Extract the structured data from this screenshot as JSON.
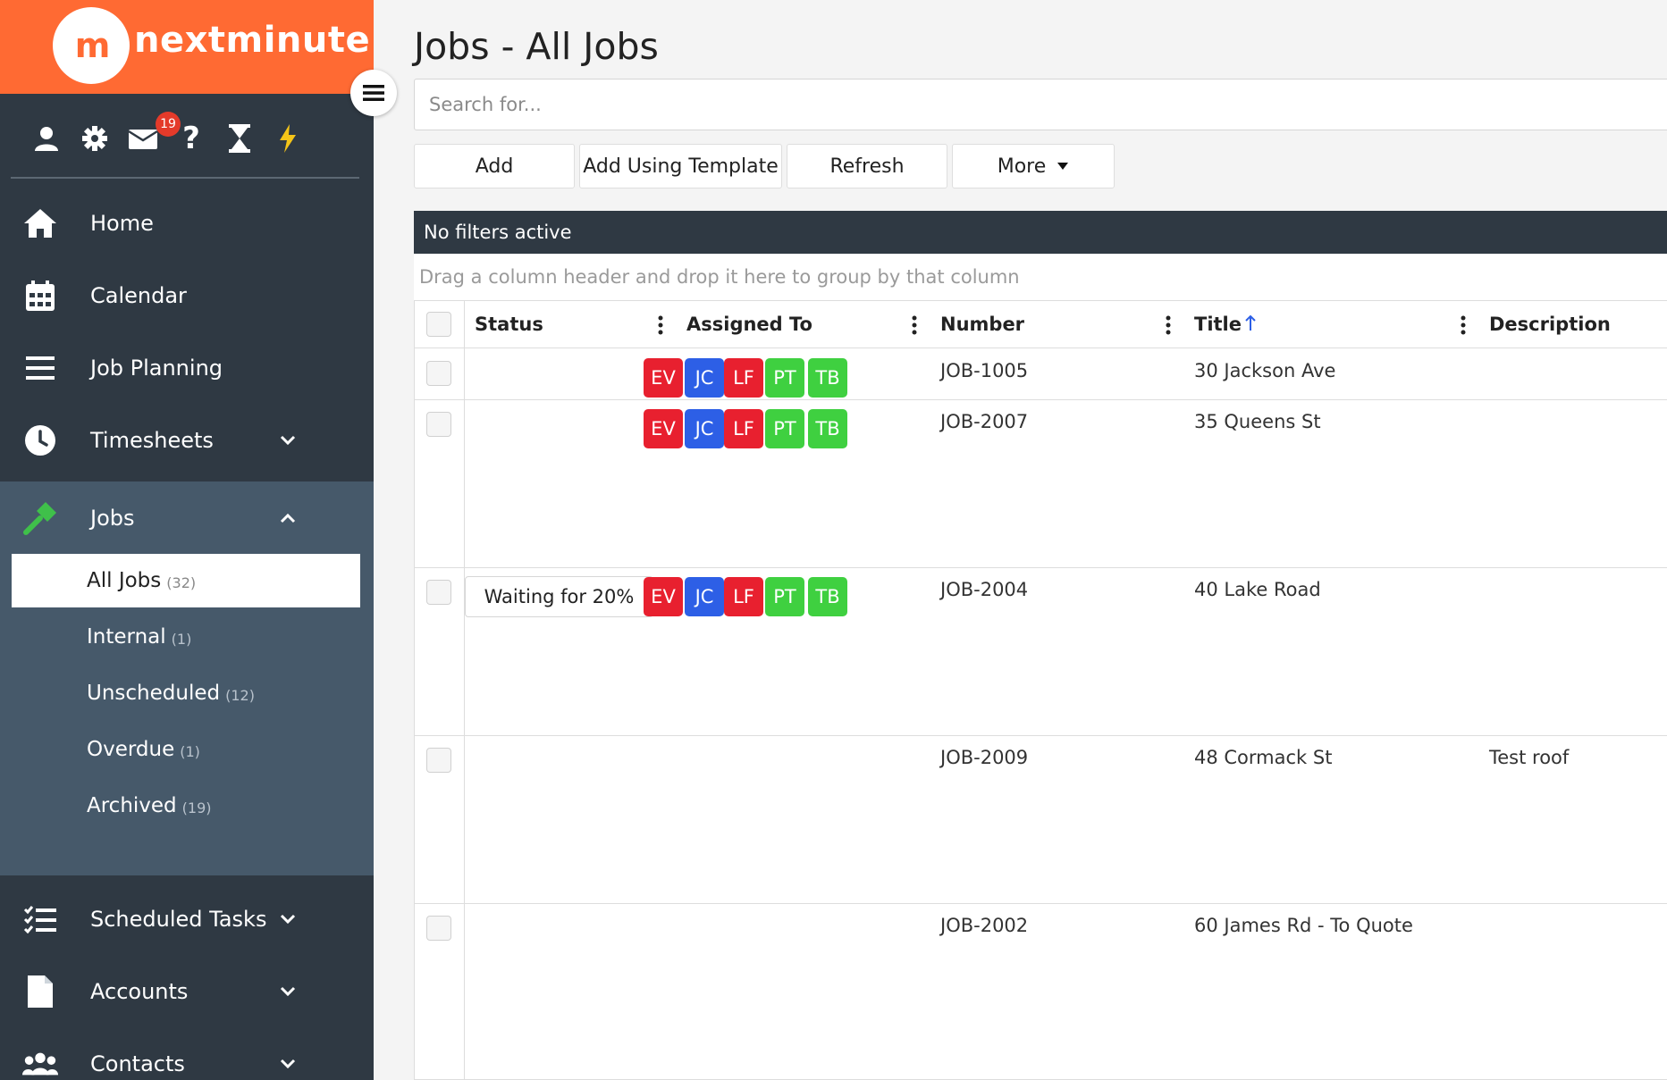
{
  "brand": {
    "logo_mark": "m",
    "name": "nextminute",
    "accent": "#ff6a33"
  },
  "toolbar": {
    "icons": [
      "user-icon",
      "gear-icon",
      "mail-icon",
      "help-icon",
      "hourglass-icon",
      "lightning-icon"
    ],
    "mail_badge": "19"
  },
  "nav": {
    "home": "Home",
    "calendar": "Calendar",
    "job_planning": "Job Planning",
    "timesheets": "Timesheets",
    "jobs": "Jobs",
    "scheduled_tasks": "Scheduled Tasks",
    "accounts": "Accounts",
    "contacts": "Contacts"
  },
  "jobs_sub": [
    {
      "label": "All Jobs",
      "count": "(32)"
    },
    {
      "label": "Internal",
      "count": "(1)"
    },
    {
      "label": "Unscheduled",
      "count": "(12)"
    },
    {
      "label": "Overdue",
      "count": "(1)"
    },
    {
      "label": "Archived",
      "count": "(19)"
    }
  ],
  "page": {
    "title": "Jobs - All Jobs"
  },
  "search": {
    "placeholder": "Search for..."
  },
  "actions": {
    "add": "Add",
    "add_template": "Add Using Template",
    "refresh": "Refresh",
    "more": "More"
  },
  "filter_bar": "No filters active",
  "group_hint": "Drag a column header and drop it here to group by that column",
  "columns": {
    "status": "Status",
    "assigned": "Assigned To",
    "number": "Number",
    "title": "Title",
    "description": "Description"
  },
  "assignee_colors": {
    "EV": "#e8202f",
    "JC": "#2d5fe6",
    "LF": "#e8202f",
    "PT": "#3fd040",
    "TB": "#3fd040"
  },
  "rows": [
    {
      "status": "",
      "assignees": [
        "EV",
        "JC",
        "LF",
        "PT",
        "TB"
      ],
      "number": "JOB-1005",
      "title": "30 Jackson Ave",
      "description": ""
    },
    {
      "status": "",
      "assignees": [
        "EV",
        "JC",
        "LF",
        "PT",
        "TB"
      ],
      "number": "JOB-2007",
      "title": "35 Queens St",
      "description": ""
    },
    {
      "status": "Waiting for 20%",
      "assignees": [
        "EV",
        "JC",
        "LF",
        "PT",
        "TB"
      ],
      "number": "JOB-2004",
      "title": "40 Lake Road",
      "description": ""
    },
    {
      "status": "",
      "assignees": [],
      "number": "JOB-2009",
      "title": "48 Cormack St",
      "description": "Test roof"
    },
    {
      "status": "",
      "assignees": [],
      "number": "JOB-2002",
      "title": "60 James Rd - To Quote",
      "description": ""
    }
  ]
}
